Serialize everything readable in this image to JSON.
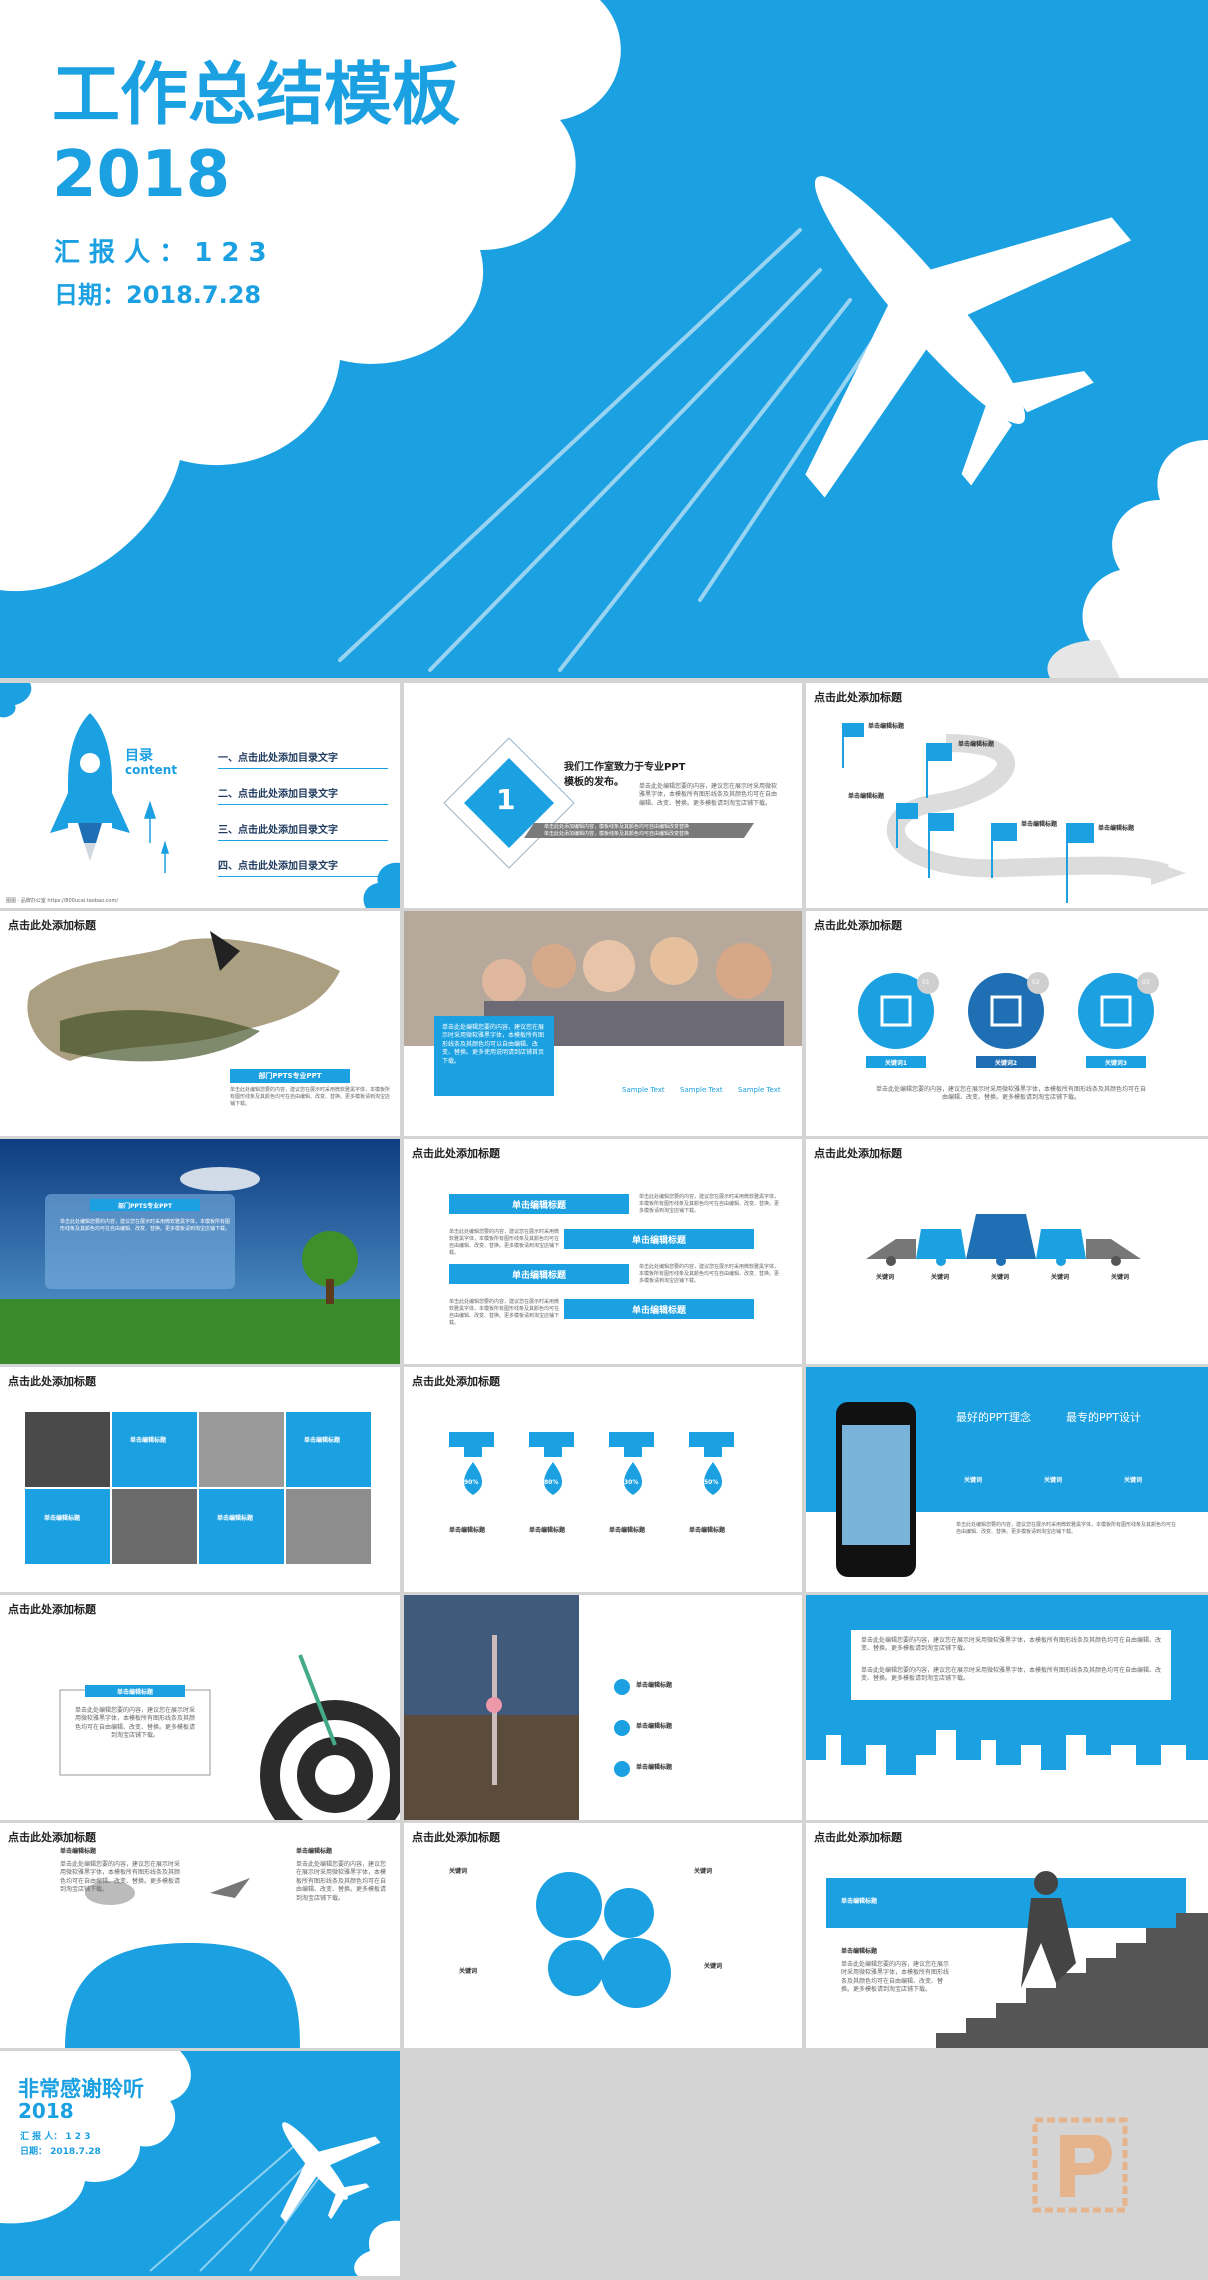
{
  "hero": {
    "title": "工作总结模板",
    "year": "2018",
    "reporter": "汇 报 人 ： 1 2 3",
    "date": "日期：2018.7.28"
  },
  "toc": {
    "heading": "目录",
    "heading_en": "content",
    "items": [
      "一、点击此处添加目录文字",
      "二、点击此处添加目录文字",
      "三、点击此处添加目录文字",
      "四、点击此处添加目录文字"
    ],
    "footer": "图图 · 品牌办公室 https://800ucai.taobao.com/"
  },
  "intro": {
    "number": "1",
    "title": "我们工作室致力于专业PPT\n模板的发布。",
    "body": "单击此处编辑您要的内容，建议您在展示时采用微软雅黑字体，本模板所有图形线条及其颜色均可在自由编辑、改变、替换。更多模板请到淘宝店铺下载。",
    "line1": "单击此处添加编辑内容，模板线条及其颜色均可自由编辑改变替换",
    "line2": "单击此处添加编辑内容，模板线条及其颜色均可自由编辑改变替换"
  },
  "common": {
    "add_title": "点击此处添加标题",
    "edit_title": "单击编辑标题",
    "keyword": "关键词",
    "sample": "Sample Text",
    "short_body": "单击此处添加编辑内容"
  },
  "climb": {
    "label": "部门PPTS专业PPT"
  },
  "people": {
    "caption": "单击此处编辑您要的内容，建议您在展示时采用微软雅黑字体，本模板所有图形线条及其颜色均可以自由编辑、改变、替换。更多使用说明请到店铺首页下载。",
    "samples": [
      "Sample Text",
      "Sample Text",
      "Sample Text"
    ]
  },
  "avatars": {
    "nums": [
      "01",
      "02",
      "03"
    ],
    "labels": [
      "关键词1",
      "关键词2",
      "关键词3"
    ]
  },
  "sky": {
    "label": "部门PPTS专业PPT"
  },
  "drops": {
    "percents": [
      "90%",
      "80%",
      "30%",
      "50%"
    ]
  },
  "phone": {
    "headline1": "最好的PPT理念",
    "headline2": "最专的PPT设计",
    "labels": [
      "关键词",
      "关键词",
      "关键词"
    ]
  },
  "ending": {
    "title": "非常感谢聆听",
    "year": "2018",
    "reporter": "汇 报 人： 1 2 3",
    "date": "日期： 2018.7.28"
  },
  "colors": {
    "accent": "#1ba0e1",
    "dark": "#1f6fb5",
    "text": "#333333",
    "background": "#d4d4d4"
  }
}
